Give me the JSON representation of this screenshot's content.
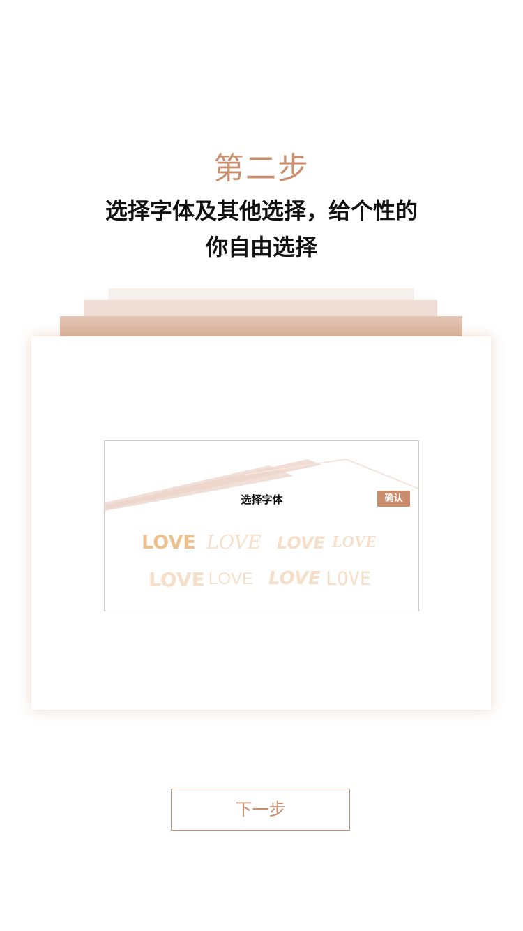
{
  "header": {
    "step_title": "第二步",
    "subtitle": "选择字体及其他选择，给个性的你自由选择"
  },
  "preview": {
    "title": "选择字体",
    "confirm_label": "确认",
    "font_samples": [
      "LOVE",
      "LOVE",
      "LOVE",
      "LOVE",
      "LOVE",
      "LOVE",
      "LOVE",
      "LOVE"
    ]
  },
  "footer": {
    "next_label": "下一步"
  },
  "colors": {
    "accent": "#c98f6e",
    "stack_light": "#f7f1ee",
    "stack_mid": "#efdcd4",
    "stack_dark": "#e2c4b3",
    "love_main": "#ecc08f",
    "love_light": "#f6dfc8"
  }
}
